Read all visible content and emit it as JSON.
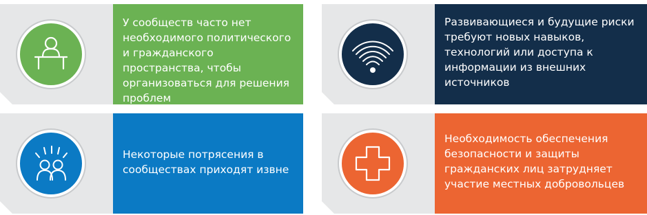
{
  "colors": {
    "green": "#6bb253",
    "navy": "#132e4a",
    "blue": "#0b7ac4",
    "orange": "#ec6532",
    "icon_panel_bg": "#e6e7e8"
  },
  "cards": [
    {
      "icon": "person-at-desk-icon",
      "text": "У сообществ часто нет необходимого политического и гражданского пространства, чтобы организоваться для решения проблем"
    },
    {
      "icon": "wifi-signal-icon",
      "text": "Развивающиеся и будущие риски требуют новых навыков, технологий или доступа к информации из внешних источников"
    },
    {
      "icon": "shocked-people-icon",
      "text": "Некоторые потрясения в сообществах приходят извне"
    },
    {
      "icon": "medical-cross-icon",
      "text": "Необходимость обеспечения безопасности и защиты гражданских лиц затрудняет участие местных добровольцев"
    }
  ]
}
